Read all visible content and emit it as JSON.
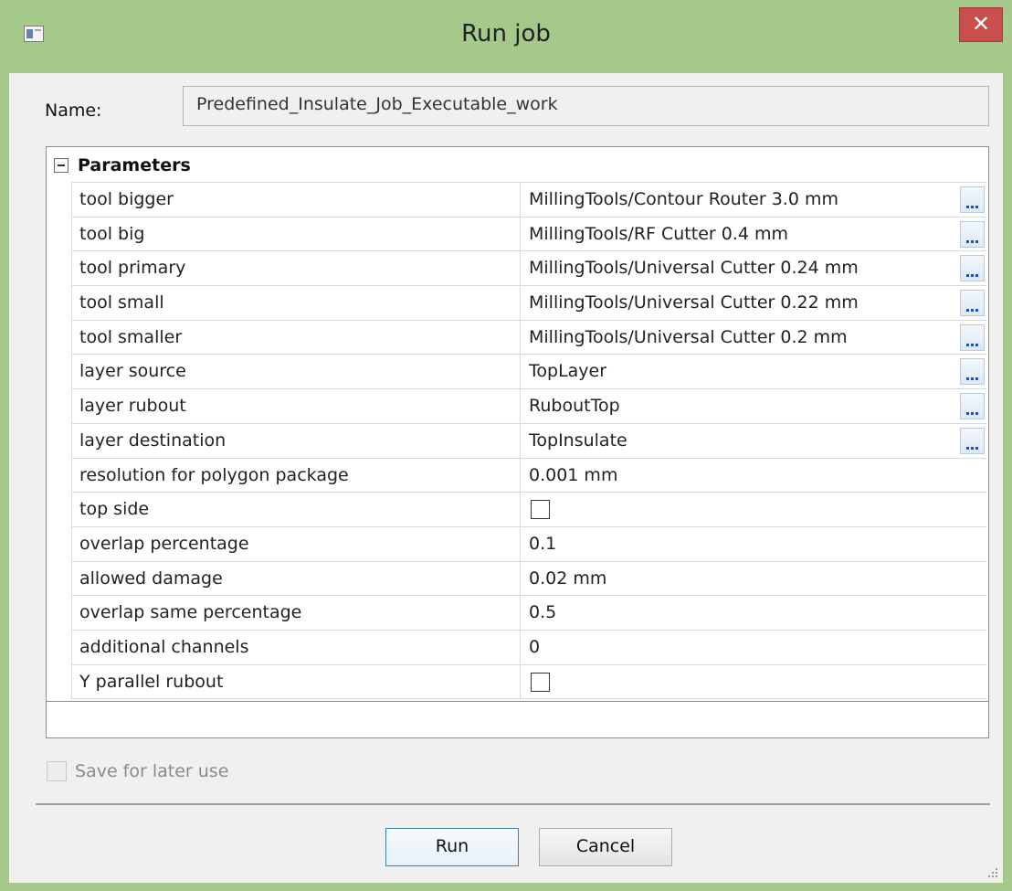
{
  "window": {
    "title": "Run job",
    "close_label": "✕"
  },
  "name_row": {
    "label": "Name:",
    "value": "Predefined_Insulate_Job_Executable_work"
  },
  "parameters": {
    "header": "Parameters",
    "rows": [
      {
        "name": "tool bigger",
        "value": "MillingTools/Contour Router 3.0 mm",
        "type": "browse"
      },
      {
        "name": "tool big",
        "value": "MillingTools/RF Cutter 0.4 mm",
        "type": "browse"
      },
      {
        "name": "tool primary",
        "value": "MillingTools/Universal Cutter 0.24 mm",
        "type": "browse"
      },
      {
        "name": "tool small",
        "value": "MillingTools/Universal Cutter 0.22 mm",
        "type": "browse"
      },
      {
        "name": "tool smaller",
        "value": "MillingTools/Universal Cutter 0.2 mm",
        "type": "browse"
      },
      {
        "name": "layer source",
        "value": "TopLayer",
        "type": "browse"
      },
      {
        "name": "layer rubout",
        "value": "RuboutTop",
        "type": "browse"
      },
      {
        "name": "layer destination",
        "value": "TopInsulate",
        "type": "browse"
      },
      {
        "name": "resolution for polygon package",
        "value": "0.001 mm",
        "type": "text"
      },
      {
        "name": "top side",
        "value": "",
        "type": "checkbox",
        "checked": false
      },
      {
        "name": "overlap percentage",
        "value": "0.1",
        "type": "text"
      },
      {
        "name": "allowed damage",
        "value": "0.02 mm",
        "type": "text"
      },
      {
        "name": "overlap same percentage",
        "value": "0.5",
        "type": "text"
      },
      {
        "name": "additional channels",
        "value": "0",
        "type": "text"
      },
      {
        "name": "Y parallel rubout",
        "value": "",
        "type": "checkbox",
        "checked": false
      }
    ]
  },
  "save_for_later": {
    "label": "Save for later use",
    "checked": false,
    "enabled": false
  },
  "buttons": {
    "run": "Run",
    "cancel": "Cancel"
  },
  "colors": {
    "frame": "#a4c98b",
    "close": "#c94f4f",
    "client_bg": "#f0f0f0",
    "browse_dots": "#1b4fbf"
  }
}
